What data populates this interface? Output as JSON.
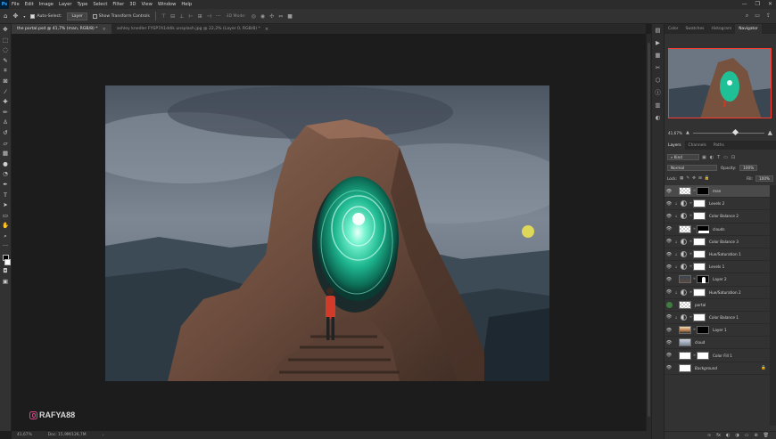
{
  "menubar": {
    "app_logo": "Ps",
    "items": [
      "File",
      "Edit",
      "Image",
      "Layer",
      "Type",
      "Select",
      "Filter",
      "3D",
      "View",
      "Window",
      "Help"
    ],
    "controls": [
      "—",
      "❐",
      "✕"
    ]
  },
  "options": {
    "auto_select_label": "Auto-Select:",
    "auto_select_value": "Layer",
    "transform_label": "Show Transform Controls",
    "mode_3d_label": "3D Mode:"
  },
  "tabs": [
    {
      "label": "the portal.psd @ 41,7% (man, RGB/8) *"
    },
    {
      "label": "ashley knedler FYSP7A1ddik unsplash.jpg @ 22,2% (Layer 0, RGB/8) *"
    }
  ],
  "status": {
    "zoom": "41,67%",
    "doc": "Doc: 15,9M/126,7M"
  },
  "watermark": {
    "text": "RAFYA88"
  },
  "panel_tabs_top": [
    "Color",
    "Swatches",
    "Histogram",
    "Navigator"
  ],
  "navigator": {
    "zoom": "41,67%"
  },
  "layers_panel": {
    "tabs": [
      "Layers",
      "Channels",
      "Paths"
    ],
    "filter_label": "Kind",
    "blend_mode": "Normal",
    "opacity_label": "Opacity:",
    "opacity_value": "100%",
    "lock_label": "Lock:",
    "fill_label": "Fill:",
    "fill_value": "100%",
    "layers": [
      {
        "name": "man",
        "thumb": "checker",
        "mask": "black",
        "selected": true,
        "adj": false
      },
      {
        "name": "Levels 2",
        "thumb": "adj",
        "mask": "white",
        "selected": false,
        "adj": true
      },
      {
        "name": "Color Balance 2",
        "thumb": "adj",
        "mask": "white",
        "selected": false,
        "adj": true
      },
      {
        "name": "clouds",
        "thumb": "checker",
        "mask": "mask-dark",
        "selected": false,
        "adj": false
      },
      {
        "name": "Color Balance 3",
        "thumb": "adj",
        "mask": "white",
        "selected": false,
        "adj": true
      },
      {
        "name": "Hue/Saturation 1",
        "thumb": "adj",
        "mask": "white",
        "selected": false,
        "adj": true
      },
      {
        "name": "Levels 1",
        "thumb": "adj",
        "mask": "white",
        "selected": false,
        "adj": true
      },
      {
        "name": "Layer 2",
        "thumb": "dark",
        "mask": "mask-fig",
        "selected": false,
        "adj": false
      },
      {
        "name": "Hue/Saturation 2",
        "thumb": "adj",
        "mask": "white",
        "selected": false,
        "adj": true
      },
      {
        "name": "portal",
        "thumb": "checker",
        "mask": null,
        "selected": false,
        "adj": false,
        "green": true
      },
      {
        "name": "Color Balance 1",
        "thumb": "adj",
        "mask": "white",
        "selected": false,
        "adj": true
      },
      {
        "name": "Layer 1",
        "thumb": "sunset",
        "mask": "black",
        "selected": false,
        "adj": false
      },
      {
        "name": "cloud",
        "thumb": "sky",
        "mask": null,
        "selected": false,
        "adj": false
      },
      {
        "name": "Color Fill 1",
        "thumb": "white",
        "mask": "white",
        "selected": false,
        "adj": false,
        "fill": true
      },
      {
        "name": "Background",
        "thumb": "white",
        "mask": null,
        "selected": false,
        "adj": false,
        "locked": true
      }
    ],
    "footer_icons": [
      "∞",
      "fx",
      "◐",
      "◑",
      "▭",
      "⊕",
      "🗑"
    ]
  },
  "colors": {
    "accent_selection": "#ff3b30",
    "portal_glow": "#3be8b8"
  }
}
